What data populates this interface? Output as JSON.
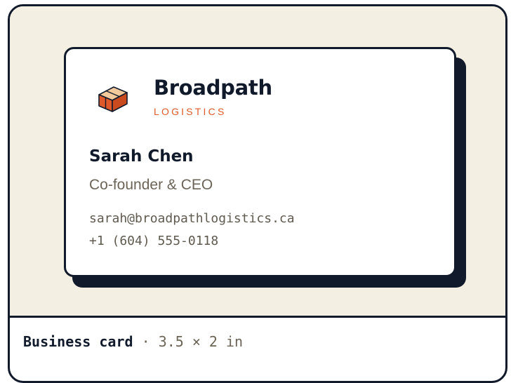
{
  "card": {
    "brand_name": "Broadpath",
    "brand_sub": "LOGISTICS",
    "person_name": "Sarah Chen",
    "person_role": "Co-founder & CEO",
    "email": "sarah@broadpathlogistics.ca",
    "phone": "+1 (604) 555-0118",
    "logo_icon": "stacked-boxes-icon"
  },
  "footer": {
    "label": "Business card",
    "separator": "·",
    "dimensions": "3.5 × 2 in"
  },
  "colors": {
    "background": "#f4efe3",
    "ink": "#111a2b",
    "accent": "#e0592a",
    "logo_light": "#f2c99a",
    "muted_text": "#6b6457"
  }
}
